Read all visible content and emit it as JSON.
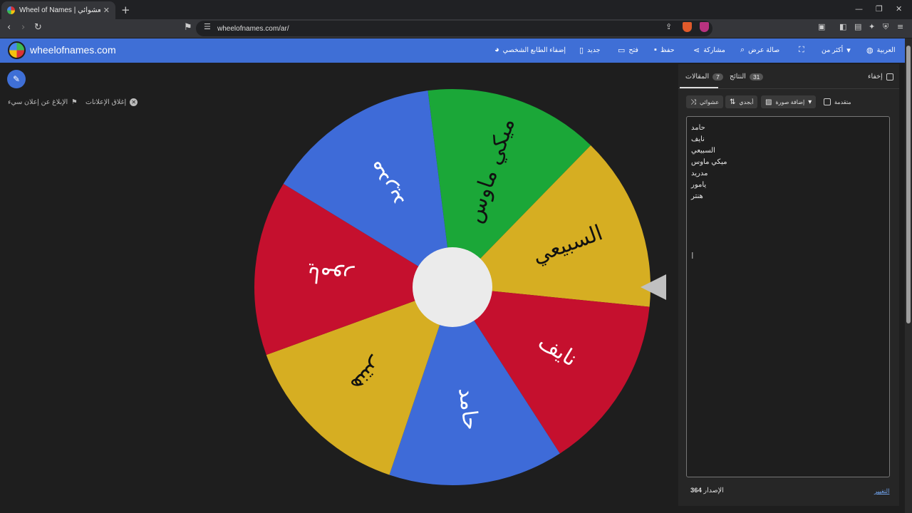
{
  "browser": {
    "tab_title": "Wheel of Names | اسم العشوائي",
    "tab_close": "✕",
    "new_tab": "+",
    "url": "wheelofnames.com/ar/",
    "brave_badge": "6",
    "alert_badge": "1"
  },
  "header": {
    "site_name": "wheelofnames.com",
    "menu": [
      {
        "icon": "palette-icon",
        "label": "إضفاء الطابع الشخصي"
      },
      {
        "icon": "file-icon",
        "label": "جديد"
      },
      {
        "icon": "folder-icon",
        "label": "فتح"
      },
      {
        "icon": "save-icon",
        "label": "حفظ"
      },
      {
        "icon": "share-icon",
        "label": "مشاركة"
      },
      {
        "icon": "search-icon",
        "label": "صالة عرض"
      },
      {
        "icon": "fullscreen-icon",
        "label": ""
      },
      {
        "icon": "chevron-down-icon",
        "label": "أكثر من"
      },
      {
        "icon": "globe-icon",
        "label": "العربية"
      }
    ]
  },
  "left": {
    "close_ads": "إغلاق الإعلانات",
    "report_ad": "الإبلاغ عن إعلان سيء"
  },
  "wheel": {
    "segments": [
      {
        "label": "ميكي ماوس",
        "color": "#1ba738"
      },
      {
        "label": "السبيعي",
        "color": "#d6ae22"
      },
      {
        "label": "نايف",
        "color": "#c5102e"
      },
      {
        "label": "حامد",
        "color": "#3e6bd8"
      },
      {
        "label": "هنتر",
        "color": "#d6ae22"
      },
      {
        "label": "يامور",
        "color": "#c5102e"
      },
      {
        "label": "مدريد",
        "color": "#3e6bd8"
      }
    ]
  },
  "panel": {
    "hide_label": "إخفاء",
    "tabs": [
      {
        "label": "المقالات",
        "count": "7"
      },
      {
        "label": "النتائج",
        "count": "31"
      }
    ],
    "shuffle_label": "عشوائي",
    "sort_label": "أبجدي",
    "add_image_label": "إضافة صورة",
    "advanced_label": "متقدمة",
    "names": [
      "حامد",
      "نايف",
      "السبيعي",
      "ميكي ماوس",
      "مدريد",
      "يامور",
      "هنتر"
    ],
    "version_label": "الإصدار",
    "version_number": "364",
    "changelog_label": "التغيير"
  }
}
